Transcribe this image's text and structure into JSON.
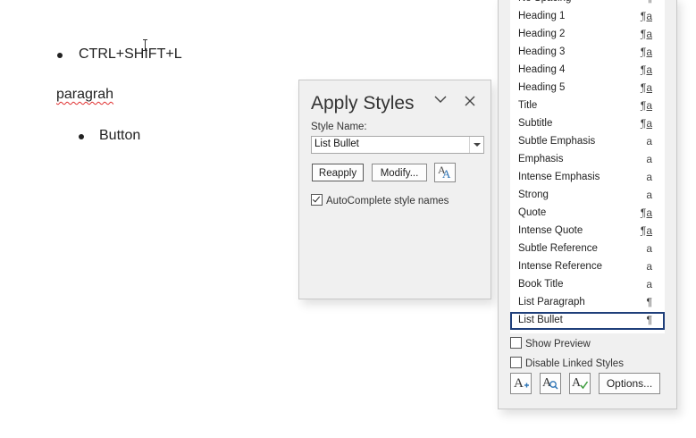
{
  "document": {
    "line1": "CTRL+SHIFT+L",
    "line2": "paragrah",
    "line3": "Button"
  },
  "apply_styles": {
    "title": "Apply Styles",
    "style_name_label": "Style Name:",
    "style_name_value": "List Bullet",
    "reapply": "Reapply",
    "modify": "Modify...",
    "autocomplete_label": "AutoComplete style names",
    "autocomplete_checked": true
  },
  "styles_pane": {
    "items": [
      {
        "name": "No Spacing",
        "type": "¶"
      },
      {
        "name": "Heading 1",
        "type": "¶a"
      },
      {
        "name": "Heading 2",
        "type": "¶a"
      },
      {
        "name": "Heading 3",
        "type": "¶a"
      },
      {
        "name": "Heading 4",
        "type": "¶a"
      },
      {
        "name": "Heading 5",
        "type": "¶a"
      },
      {
        "name": "Title",
        "type": "¶a"
      },
      {
        "name": "Subtitle",
        "type": "¶a"
      },
      {
        "name": "Subtle Emphasis",
        "type": "a"
      },
      {
        "name": "Emphasis",
        "type": "a"
      },
      {
        "name": "Intense Emphasis",
        "type": "a"
      },
      {
        "name": "Strong",
        "type": "a"
      },
      {
        "name": "Quote",
        "type": "¶a"
      },
      {
        "name": "Intense Quote",
        "type": "¶a"
      },
      {
        "name": "Subtle Reference",
        "type": "a"
      },
      {
        "name": "Intense Reference",
        "type": "a"
      },
      {
        "name": "Book Title",
        "type": "a"
      },
      {
        "name": "List Paragraph",
        "type": "¶"
      },
      {
        "name": "List Bullet",
        "type": "¶"
      }
    ],
    "selected": "List Bullet",
    "show_preview_label": "Show Preview",
    "disable_linked_label": "Disable Linked Styles",
    "options_label": "Options..."
  },
  "colors": {
    "selection_border": "#1f3f7a",
    "spell_underline": "#e03030",
    "style_icon_blue": "#2e75b6"
  }
}
